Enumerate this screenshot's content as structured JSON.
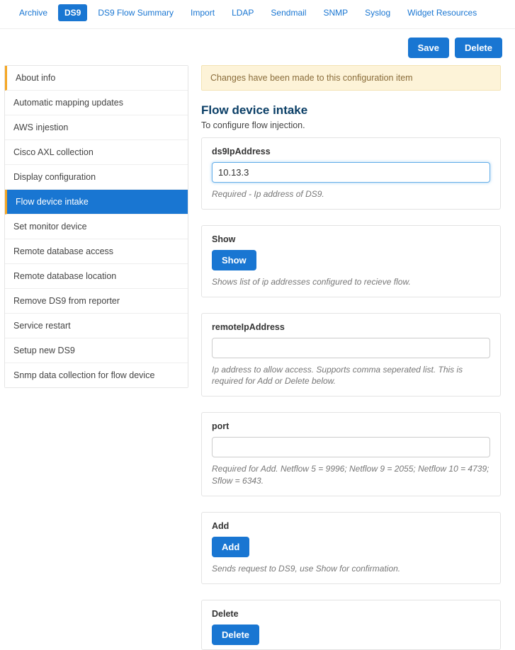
{
  "topnav": {
    "items": [
      {
        "label": "Archive",
        "active": false
      },
      {
        "label": "DS9",
        "active": true
      },
      {
        "label": "DS9 Flow Summary",
        "active": false
      },
      {
        "label": "Import",
        "active": false
      },
      {
        "label": "LDAP",
        "active": false
      },
      {
        "label": "Sendmail",
        "active": false
      },
      {
        "label": "SNMP",
        "active": false
      },
      {
        "label": "Syslog",
        "active": false
      },
      {
        "label": "Widget Resources",
        "active": false
      }
    ]
  },
  "actions": {
    "save": "Save",
    "delete": "Delete"
  },
  "sidebar": {
    "items": [
      {
        "label": "About info",
        "active": false,
        "accent": true
      },
      {
        "label": "Automatic mapping updates",
        "active": false,
        "accent": false
      },
      {
        "label": "AWS injestion",
        "active": false,
        "accent": false
      },
      {
        "label": "Cisco AXL collection",
        "active": false,
        "accent": false
      },
      {
        "label": "Display configuration",
        "active": false,
        "accent": false
      },
      {
        "label": "Flow device intake",
        "active": true,
        "accent": true
      },
      {
        "label": "Set monitor device",
        "active": false,
        "accent": false
      },
      {
        "label": "Remote database access",
        "active": false,
        "accent": false
      },
      {
        "label": "Remote database location",
        "active": false,
        "accent": false
      },
      {
        "label": "Remove DS9 from reporter",
        "active": false,
        "accent": false
      },
      {
        "label": "Service restart",
        "active": false,
        "accent": false
      },
      {
        "label": "Setup new DS9",
        "active": false,
        "accent": false
      },
      {
        "label": "Snmp data collection for flow device",
        "active": false,
        "accent": false
      }
    ]
  },
  "alert": "Changes have been made to this configuration item",
  "page": {
    "title": "Flow device intake",
    "subtitle": "To configure flow injection."
  },
  "fields": {
    "ds9IpAddress": {
      "label": "ds9IpAddress",
      "value": "10.13.3",
      "help": "Required - Ip address of DS9."
    },
    "show": {
      "label": "Show",
      "button": "Show",
      "help": "Shows list of ip addresses configured to recieve flow."
    },
    "remoteIpAddress": {
      "label": "remoteIpAddress",
      "value": "",
      "help": "Ip address to allow access. Supports comma seperated list. This is required for Add or Delete below."
    },
    "port": {
      "label": "port",
      "value": "",
      "help": "Required for Add. Netflow 5 = 9996; Netflow 9 = 2055; Netflow 10 = 4739; Sflow = 6343."
    },
    "add": {
      "label": "Add",
      "button": "Add",
      "help": "Sends request to DS9, use Show for confirmation."
    },
    "delete": {
      "label": "Delete",
      "button": "Delete"
    }
  }
}
